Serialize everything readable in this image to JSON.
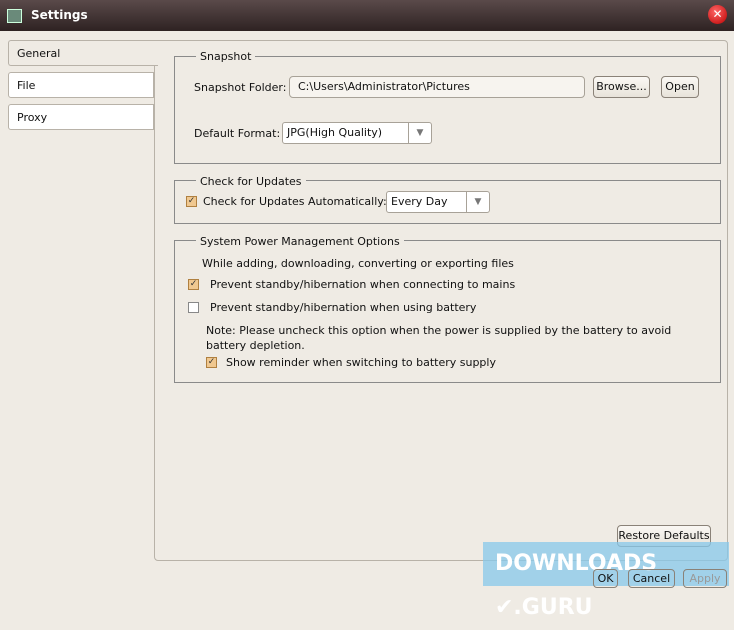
{
  "window": {
    "title": "Settings"
  },
  "tabs": [
    {
      "label": "General"
    },
    {
      "label": "File"
    },
    {
      "label": "Proxy"
    }
  ],
  "snapshot": {
    "group": "Snapshot",
    "folder_label": "Snapshot Folder:",
    "folder_value": "C:\\Users\\Administrator\\Pictures",
    "browse": "Browse...",
    "open": "Open",
    "format_label": "Default Format:",
    "format_value": "JPG(High Quality)"
  },
  "updates": {
    "group": "Check for Updates",
    "auto_label": "Check for Updates Automatically:",
    "auto_checked": true,
    "frequency": "Every Day"
  },
  "power": {
    "group": "System Power Management Options",
    "intro": "While adding, downloading, converting or exporting files",
    "mains_label": "Prevent standby/hibernation when connecting to mains",
    "mains_checked": true,
    "battery_label": "Prevent standby/hibernation when using battery",
    "battery_checked": false,
    "note": "Note: Please uncheck this option when the power is supplied by the battery to avoid battery depletion.",
    "reminder_label": "Show reminder when switching to battery supply",
    "reminder_checked": true
  },
  "buttons": {
    "restore": "Restore Defaults",
    "ok": "OK",
    "cancel": "Cancel",
    "apply": "Apply"
  },
  "watermark": "DOWNLOADS .GURU"
}
